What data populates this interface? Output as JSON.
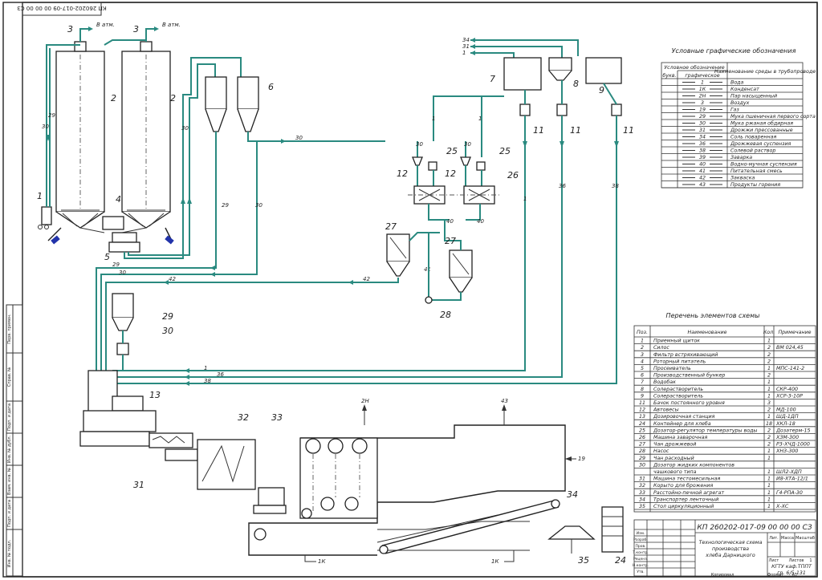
{
  "drawing_code_top": "КП 260202-017-09 00 00 00 СЗ",
  "vent_label": "В атм.",
  "equipment_numbers": {
    "n1": "1",
    "n2": "2",
    "n3": "3",
    "n4": "4",
    "n5": "5",
    "n6": "6",
    "n7": "7",
    "n8": "8",
    "n9": "9",
    "n11": "11",
    "n12": "12",
    "n13": "13",
    "n24": "24",
    "n25": "25",
    "n26": "26",
    "n27": "27",
    "n28": "28",
    "n29": "29",
    "n30": "30",
    "n31": "31",
    "n32": "32",
    "n33": "33",
    "n34": "34",
    "n35": "35"
  },
  "pipe_labels": {
    "p1": "1",
    "p29": "29",
    "p30": "30",
    "p31": "31",
    "p34": "34",
    "p36": "36",
    "p38": "38",
    "p40": "40",
    "p41": "41",
    "p42": "42",
    "p43": "43",
    "p2n": "2Н",
    "p19": "19",
    "p1k": "1К"
  },
  "legend": {
    "title": "Условные графические обозначения",
    "head_symbol": "Условное обозначение",
    "head_letter": "букв.",
    "head_graphic": "графическое",
    "head_medium": "Наименование среды в трубопроводе",
    "rows": [
      {
        "code": "1",
        "medium": "Вода"
      },
      {
        "code": "1К",
        "medium": "Конденсат"
      },
      {
        "code": "2Н",
        "medium": "Пар насыщенный"
      },
      {
        "code": "3",
        "medium": "Воздух"
      },
      {
        "code": "19",
        "medium": "Газ"
      },
      {
        "code": "29",
        "medium": "Мука пшеничная первого сорта"
      },
      {
        "code": "30",
        "medium": "Мука ржаная обдирная"
      },
      {
        "code": "31",
        "medium": "Дрожжи прессованные"
      },
      {
        "code": "34",
        "medium": "Соль поваренная"
      },
      {
        "code": "36",
        "medium": "Дрожжевая суспензия"
      },
      {
        "code": "38",
        "medium": "Солевой раствор"
      },
      {
        "code": "39",
        "medium": "Заварка"
      },
      {
        "code": "40",
        "medium": "Водно-мучная суспензия"
      },
      {
        "code": "41",
        "medium": "Питательная смесь"
      },
      {
        "code": "42",
        "medium": "Закваска"
      },
      {
        "code": "43",
        "medium": "Продукты горения"
      }
    ]
  },
  "spec": {
    "title": "Перечень элементов схемы",
    "head_pos": "Поз.",
    "head_name": "Наименование",
    "head_qty": "Кол.",
    "head_note": "Примечание",
    "rows": [
      {
        "pos": "1",
        "name": "Приемный щиток",
        "qty": "1",
        "note": ""
      },
      {
        "pos": "2",
        "name": "Силос",
        "qty": "2",
        "note": "ВМ 024,45"
      },
      {
        "pos": "3",
        "name": "Фильтр встряхивающий",
        "qty": "2",
        "note": ""
      },
      {
        "pos": "4",
        "name": "Роторный питатель",
        "qty": "2",
        "note": ""
      },
      {
        "pos": "5",
        "name": "Просеиватель",
        "qty": "1",
        "note": "МПС-141-2"
      },
      {
        "pos": "6",
        "name": "Производственный бункер",
        "qty": "2",
        "note": ""
      },
      {
        "pos": "7",
        "name": "Водобак",
        "qty": "1",
        "note": ""
      },
      {
        "pos": "8",
        "name": "Солерастворитель",
        "qty": "1",
        "note": "СКР-400"
      },
      {
        "pos": "9",
        "name": "Солерастворитель",
        "qty": "1",
        "note": "ХСР-3-10Р"
      },
      {
        "pos": "11",
        "name": "Бачок постоянного уровня",
        "qty": "3",
        "note": ""
      },
      {
        "pos": "12",
        "name": "Автовесы",
        "qty": "2",
        "note": "МД-100"
      },
      {
        "pos": "13",
        "name": "Дозировочная станция",
        "qty": "1",
        "note": "ШД-1ДП"
      },
      {
        "pos": "24",
        "name": "Контейнер для хлеба",
        "qty": "18",
        "note": "ХКЛ-18"
      },
      {
        "pos": "25",
        "name": "Дозатор-регулятор температуры воды",
        "qty": "2",
        "note": "Дозатерм-15"
      },
      {
        "pos": "26",
        "name": "Машина заварочная",
        "qty": "2",
        "note": "ХЗМ-300"
      },
      {
        "pos": "27",
        "name": "Чан дрожжевой",
        "qty": "2",
        "note": "Р3-ХЧД-1000"
      },
      {
        "pos": "28",
        "name": "Насос",
        "qty": "1",
        "note": "ХНЗ-300"
      },
      {
        "pos": "29",
        "name": "Чан расходный",
        "qty": "1",
        "note": ""
      },
      {
        "pos": "30",
        "name": "Дозатор жидких компонентов",
        "qty": "",
        "note": ""
      },
      {
        "pos": "",
        "name": "чашкового типа",
        "qty": "1",
        "note": "ШЛ2-ХДП"
      },
      {
        "pos": "31",
        "name": "Машина тестомесильная",
        "qty": "1",
        "note": "И8-ХТА-12/1"
      },
      {
        "pos": "32",
        "name": "Корыто для брожения",
        "qty": "1",
        "note": ""
      },
      {
        "pos": "33",
        "name": "Расстойно-печной агрегат",
        "qty": "1",
        "note": "Г4-РПА-30"
      },
      {
        "pos": "34",
        "name": "Транспортер ленточный",
        "qty": "1",
        "note": ""
      },
      {
        "pos": "35",
        "name": "Стол циркуляционный",
        "qty": "1",
        "note": "Х-ХС"
      }
    ]
  },
  "title_block": {
    "code": "КП 260202-017-09 00 00 00 СЗ",
    "name_line1": "Технологическая схема",
    "name_line2": "производства",
    "name_line3": "хлеба Дарницкого",
    "col_lit": "Лит.",
    "col_mass": "Масса",
    "col_scale": "Масштаб",
    "sheet": "Лист",
    "sheets": "Листов",
    "sheets_count": "1",
    "org_line1": "КГТУ каф.ТППТ",
    "org_line2": "гр. 6/5-131",
    "roles": [
      "Изм.",
      "Разраб.",
      "Пров.",
      "Т.контр.",
      "Реценз.",
      "Н.контр.",
      "Утв."
    ],
    "copied": "Копировал",
    "format": "Формат",
    "format_val": "А1"
  },
  "side_stamp": [
    "Перв. примен.",
    "Справ. №",
    "Подп. и дата",
    "Инв. № дубл.",
    "Взам. инв. №",
    "Подп. и дата",
    "Инв. № подл."
  ]
}
